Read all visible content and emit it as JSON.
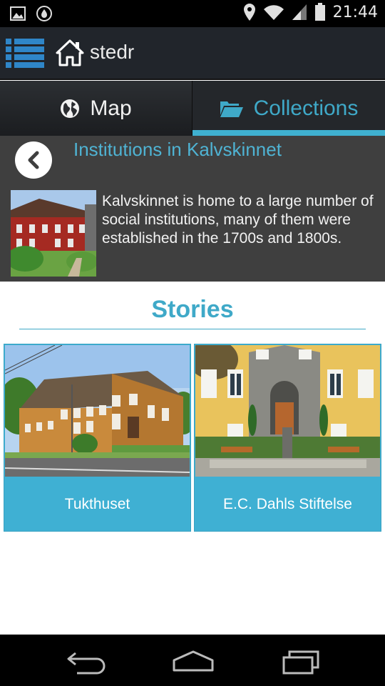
{
  "status_bar": {
    "time": "21:44",
    "icons": [
      "image-icon",
      "sync-icon",
      "location-icon",
      "wifi-icon",
      "signal-icon",
      "battery-icon"
    ]
  },
  "action_bar": {
    "title": "stedr",
    "icons": [
      "menu-list-icon",
      "home-icon"
    ]
  },
  "tabs": [
    {
      "label": "Map",
      "icon": "globe-icon",
      "active": false
    },
    {
      "label": "Collections",
      "icon": "folder-open-icon",
      "active": true
    }
  ],
  "collection": {
    "title": "Institutions in Kalvskinnet",
    "description": "Kalvskinnet is home to a large number of social institutions, many of them were established in the 1700s and 1800s."
  },
  "stories": {
    "heading": "Stories",
    "items": [
      {
        "title": "Tukthuset"
      },
      {
        "title": "E.C. Dahls Stiftelse"
      }
    ]
  },
  "nav_bar": {
    "buttons": [
      "back-icon",
      "home-icon",
      "recents-icon"
    ]
  },
  "colors": {
    "accent": "#3fb0d3",
    "accent_text": "#3fa9c8",
    "action_bar": "#21252b",
    "header_bg": "#3f3f3f"
  }
}
